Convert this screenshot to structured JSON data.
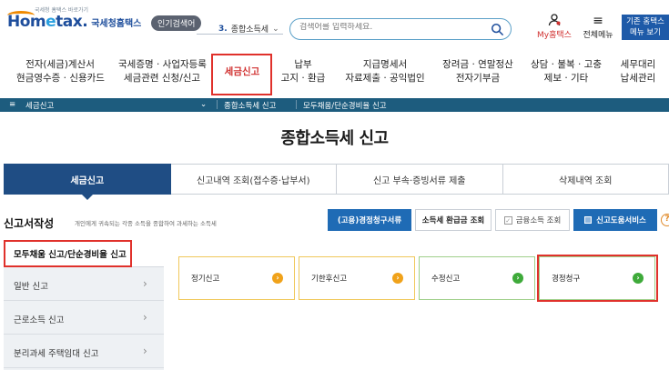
{
  "header": {
    "logo_small": "국세청 홈택스 바로가기",
    "logo_text_pre": "Hom",
    "logo_text_dot": "e",
    "logo_text_post": "tax.",
    "logo_sub": "국세청홈택스",
    "popular_label": "인기검색어",
    "popular_rank": "3.",
    "popular_term": "종합소득세",
    "search_placeholder": "검색어를 입력하세요.",
    "my_hometax": "My홈택스",
    "all_menu": "전체메뉴",
    "old_hometax_line1": "기존 홈택스",
    "old_hometax_line2": "메뉴 보기"
  },
  "mainnav": {
    "items": [
      {
        "line1": "전자(세금)계산서",
        "line2": "현금영수증 · 신용카드"
      },
      {
        "line1": "국세증명 · 사업자등록",
        "line2": "세금관련 신청/신고"
      },
      {
        "line1": "세금신고",
        "line2": ""
      },
      {
        "line1": "납부",
        "line2": "고지 · 환급"
      },
      {
        "line1": "지급명세서",
        "line2": "자료제출 · 공익법인"
      },
      {
        "line1": "장려금 · 연말정산",
        "line2": "전자기부금"
      },
      {
        "line1": "상담 · 불복 · 고충",
        "line2": "제보 · 기타"
      },
      {
        "line1": "세무대리",
        "line2": "납세관리"
      }
    ]
  },
  "crumbbar": {
    "menu_icon": "≡",
    "current": "세금신고",
    "dropdown_icon": "⌄",
    "level2": "종합소득세 신고",
    "level3": "모두채움/단순경비율 신고"
  },
  "page_title": "종합소득세 신고",
  "tabs": [
    {
      "label": "세금신고",
      "active": true
    },
    {
      "label": "신고내역 조회(접수증·납부서)",
      "active": false
    },
    {
      "label": "신고 부속·증빙서류 제출",
      "active": false
    },
    {
      "label": "삭제내역 조회",
      "active": false
    }
  ],
  "section": {
    "title": "신고서작성",
    "desc": "개인에게 귀속되는 각종 소득을 종합하여 과세하는 소득세",
    "btn_gyeongjeong": "(고용)경정청구서류",
    "btn_refund": "소득세 환급금 조회",
    "btn_finance": "금융소득 조회",
    "btn_help_service": "신고도움서비스",
    "help_icon": "?"
  },
  "leftmenu": {
    "head": "모두채움 신고/단순경비율 신고",
    "rows": [
      "일반 신고",
      "근로소득 신고",
      "분리과세 주택임대 신고"
    ]
  },
  "cards": [
    {
      "label": "정기신고",
      "color": "orange"
    },
    {
      "label": "기한후신고",
      "color": "orange"
    },
    {
      "label": "수정신고",
      "color": "green"
    },
    {
      "label": "경정청구",
      "color": "green"
    }
  ],
  "colors": {
    "brand_blue": "#1e4e9c",
    "active_red": "#d0302f",
    "crumb_bar": "#1d5c7e",
    "tab_active": "#1f4d84",
    "highlight_red": "#e0312b",
    "btn_blue": "#1f6bb5"
  }
}
